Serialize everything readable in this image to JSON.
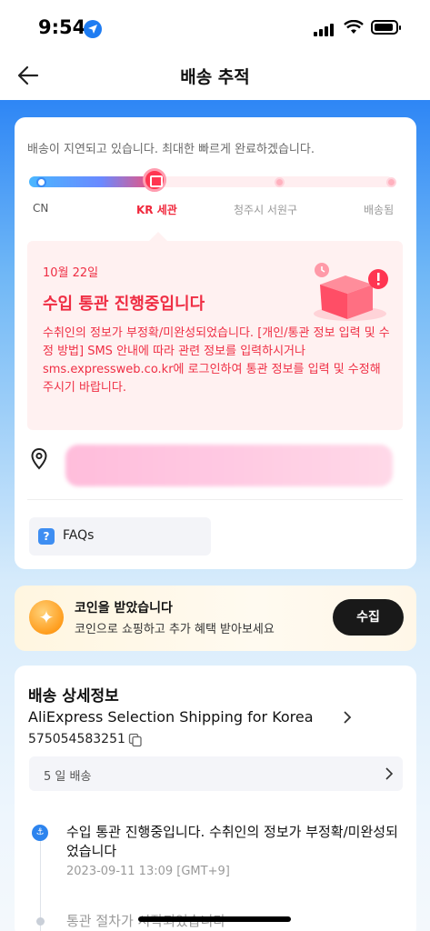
{
  "status_bar": {
    "time": "9:54"
  },
  "nav": {
    "title": "배송 추적"
  },
  "progress": {
    "delay_message": "배송이 지연되고 있습니다. 최대한 빠르게 완료하겠습니다.",
    "steps": [
      "CN",
      "KR 세관",
      "청주시 서원구",
      "배송됨"
    ],
    "current_step_index": 1
  },
  "notice": {
    "date": "10월 22일",
    "title": "수입 통관 진행중입니다",
    "body": "수취인의 정보가 부정확/미완성되었습니다. [개인/통관 정보 입력 및 수정 방법] SMS 안내에 따라 관련 정보를 입력하시거나 sms.expressweb.co.kr에 로그인하여 통관 정보를 입력 및 수정해 주시기 바랍니다."
  },
  "faq": {
    "label": "FAQs",
    "icon_char": "?"
  },
  "coin": {
    "title": "코인을 받았습니다",
    "subtitle": "코인으로 쇼핑하고 추가 혜택 받아보세요",
    "button": "수집"
  },
  "details": {
    "heading": "배송 상세정보",
    "carrier": "AliExpress Selection Shipping for Korea",
    "tracking_number": "575054583251",
    "days": "5 일 배송",
    "events": [
      {
        "title": "수입 통관 진행중입니다. 수취인의 정보가 부정확/미완성되었습니다",
        "time": "2023-09-11 13:09 [GMT+9]"
      },
      {
        "title": "통관 절차가 시작되었습니다"
      }
    ]
  },
  "colors": {
    "accent": "#ef2e44",
    "primary": "#2e86f5",
    "coin_button": "#191919"
  }
}
